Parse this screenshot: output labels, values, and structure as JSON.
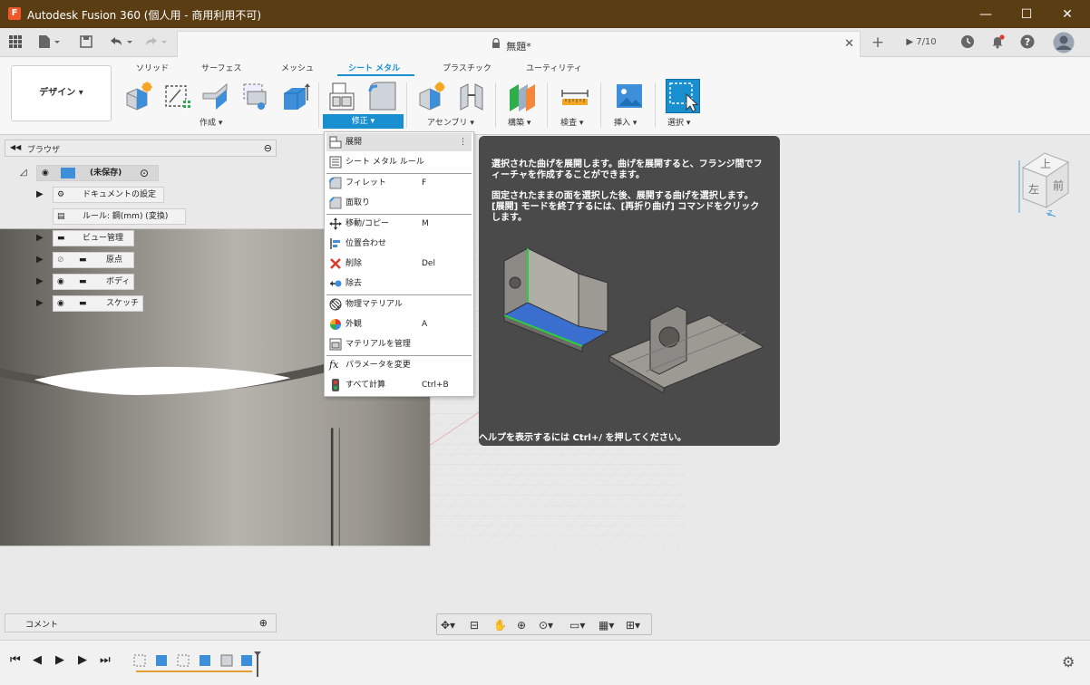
{
  "titlebar": {
    "logo": "F",
    "title": "Autodesk Fusion 360 (個人用 - 商用利用不可)",
    "minimize": "—",
    "maximize": "☐",
    "close": "✕"
  },
  "tabbar": {
    "doc_title": "無題*",
    "version": "7/10"
  },
  "ribbon": {
    "workspace": "デザイン ▾",
    "tabs": [
      "ソリッド",
      "サーフェス",
      "メッシュ",
      "シート メタル",
      "プラスチック",
      "ユーティリティ"
    ],
    "active_tab": "シート メタル",
    "groups": {
      "create": "作成 ▾",
      "modify": "修正 ▾",
      "assemble": "アセンブリ ▾",
      "construct": "構築 ▾",
      "inspect": "検査 ▾",
      "insert": "挿入 ▾",
      "select": "選択 ▾"
    }
  },
  "browser": {
    "title": "ブラウザ",
    "root": "(未保存)",
    "items": [
      "ドキュメントの設定",
      "ルール: 鋼(mm) (変換)",
      "ビュー管理",
      "原点",
      "ボディ",
      "スケッチ"
    ]
  },
  "comments": {
    "label": "コメント"
  },
  "menu": {
    "items": [
      {
        "label": "展開",
        "shortcut": ""
      },
      {
        "label": "シート メタル ルール",
        "shortcut": ""
      },
      {
        "label": "フィレット",
        "shortcut": "F"
      },
      {
        "label": "面取り",
        "shortcut": ""
      },
      {
        "label": "移動/コピー",
        "shortcut": "M"
      },
      {
        "label": "位置合わせ",
        "shortcut": ""
      },
      {
        "label": "削除",
        "shortcut": "Del"
      },
      {
        "label": "除去",
        "shortcut": ""
      },
      {
        "label": "物理マテリアル",
        "shortcut": ""
      },
      {
        "label": "外観",
        "shortcut": "A"
      },
      {
        "label": "マテリアルを管理",
        "shortcut": ""
      },
      {
        "label": "パラメータを変更",
        "shortcut": ""
      },
      {
        "label": "すべて計算",
        "shortcut": "Ctrl+B"
      }
    ]
  },
  "tooltip": {
    "p1": "選択された曲げを展開します。曲げを展開すると、フランジ間でフィーチャを作成することができます。",
    "p2": "固定されたままの面を選択した後、展開する曲げを選択します。[展開] モードを終了するには、[再折り曲げ] コマンドをクリックします。",
    "footer": "ヘルプを表示するには Ctrl+/ を押してください。"
  },
  "viewcube": {
    "top": "上",
    "left": "左",
    "front": "前",
    "axis_z": "Z"
  },
  "colors": {
    "accent": "#1a8fd0",
    "titlebar": "#5a3d13",
    "tooltip_bg": "#4a4a4a"
  }
}
